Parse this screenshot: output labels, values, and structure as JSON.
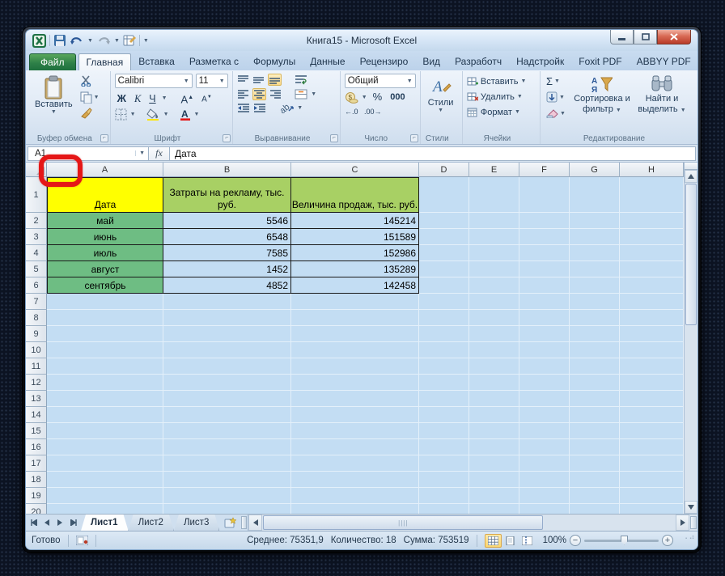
{
  "window": {
    "title": "Книга15 - Microsoft Excel"
  },
  "ribbon": {
    "file_tab": "Файл",
    "active_tab": "Главная",
    "tabs": [
      "Главная",
      "Вставка",
      "Разметка с",
      "Формулы",
      "Данные",
      "Рецензиро",
      "Вид",
      "Разработч",
      "Надстройк",
      "Foxit PDF",
      "ABBYY PDF"
    ],
    "clipboard_group": {
      "label": "Буфер обмена",
      "paste": "Вставить"
    },
    "font_group": {
      "label": "Шрифт",
      "font_name": "Calibri",
      "font_size": "11",
      "bold": "Ж",
      "italic": "К",
      "underline": "Ч",
      "grow_shrink": "А"
    },
    "alignment_group": {
      "label": "Выравнивание"
    },
    "number_group": {
      "label": "Число",
      "format": "Общий",
      "percent": "%",
      "thousands": "000"
    },
    "styles_group": {
      "label": "Стили",
      "styles": "Стили"
    },
    "cells_group": {
      "label": "Ячейки",
      "insert": "Вставить",
      "delete": "Удалить",
      "format": "Формат"
    },
    "editing_group": {
      "label": "Редактирование",
      "sigma": "Σ",
      "sort": "Сортировка и фильтр",
      "find": "Найти и выделить"
    }
  },
  "formula_bar": {
    "name_box": "A1",
    "fx": "fx",
    "value": "Дата"
  },
  "grid": {
    "columns": [
      "A",
      "B",
      "C",
      "D",
      "E",
      "F",
      "G",
      "H"
    ],
    "rows": [
      "1",
      "2",
      "3",
      "4",
      "5",
      "6",
      "7",
      "8",
      "9",
      "10",
      "11",
      "12",
      "13",
      "14",
      "15",
      "16",
      "17",
      "18",
      "19",
      "20"
    ],
    "table": {
      "headers": [
        "Дата",
        "Затраты на рекламу, тыс. руб.",
        "Величина продаж, тыс. руб."
      ],
      "data": [
        [
          "май",
          "5546",
          "145214"
        ],
        [
          "июнь",
          "6548",
          "151589"
        ],
        [
          "июль",
          "7585",
          "152986"
        ],
        [
          "август",
          "1452",
          "135289"
        ],
        [
          "сентябрь",
          "4852",
          "142458"
        ]
      ]
    }
  },
  "sheet_bar": {
    "tabs": [
      "Лист1",
      "Лист2",
      "Лист3"
    ],
    "active": "Лист1"
  },
  "status_bar": {
    "mode": "Готово",
    "average": "Среднее: 75351,9",
    "count": "Количество: 18",
    "sum": "Сумма: 753519",
    "zoom": "100%"
  },
  "colors": {
    "cell_yellow": "#FFFF00",
    "cell_header_green": "#A8D064",
    "cell_month_green": "#6EBD83",
    "selection_blue": "#C3DDF3",
    "file_tab_green": "#2E8048",
    "annotation_red": "#E51717"
  }
}
